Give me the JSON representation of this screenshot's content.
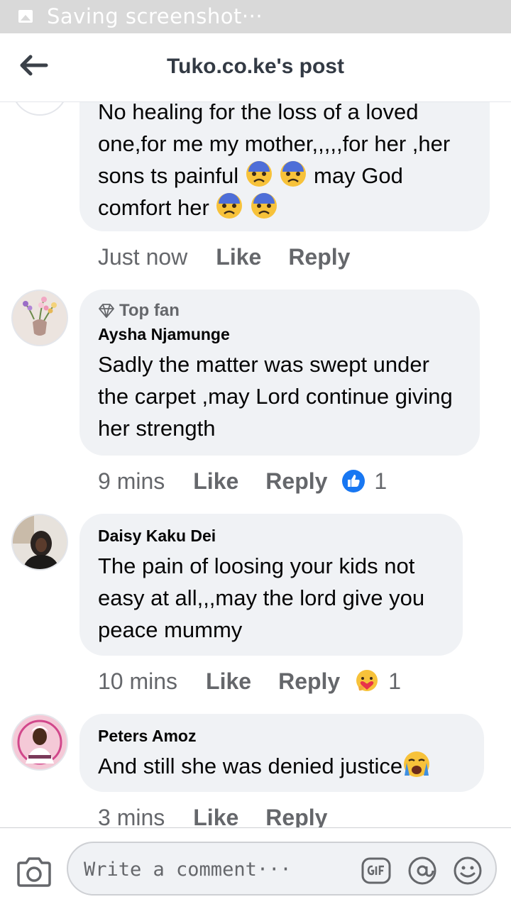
{
  "status_bar": {
    "text": "Saving screenshot···"
  },
  "header": {
    "title": "Tuko.co.ke's post"
  },
  "comments": [
    {
      "text": "No healing for the loss of a loved one,for me my mother,,,,,for her ,her sons ts painful",
      "text_2": "may God comfort her",
      "time": "Just now",
      "like_label": "Like",
      "reply_label": "Reply"
    },
    {
      "badge": "Top fan",
      "author": "Aysha Njamunge",
      "text": "Sadly the matter was swept under the carpet ,may Lord continue giving her strength",
      "time": "9 mins",
      "like_label": "Like",
      "reply_label": "Reply",
      "reaction_count": "1",
      "reaction_icon": "like-reaction-icon"
    },
    {
      "author": "Daisy Kaku Dei",
      "text": "The pain of loosing your kids not easy at all,,,may the lord give you peace mummy",
      "time": "10 mins",
      "like_label": "Like",
      "reply_label": "Reply",
      "reaction_count": "1",
      "reaction_icon": "care-reaction-icon"
    },
    {
      "author": "Peters Amoz",
      "text": "And still she was denied justice",
      "time": "3 mins",
      "like_label": "Like",
      "reply_label": "Reply"
    }
  ],
  "composer": {
    "placeholder": "Write a comment···"
  },
  "colors": {
    "bubble": "#f0f2f5",
    "secondary_text": "#65676b",
    "like_blue": "#1877f2"
  }
}
